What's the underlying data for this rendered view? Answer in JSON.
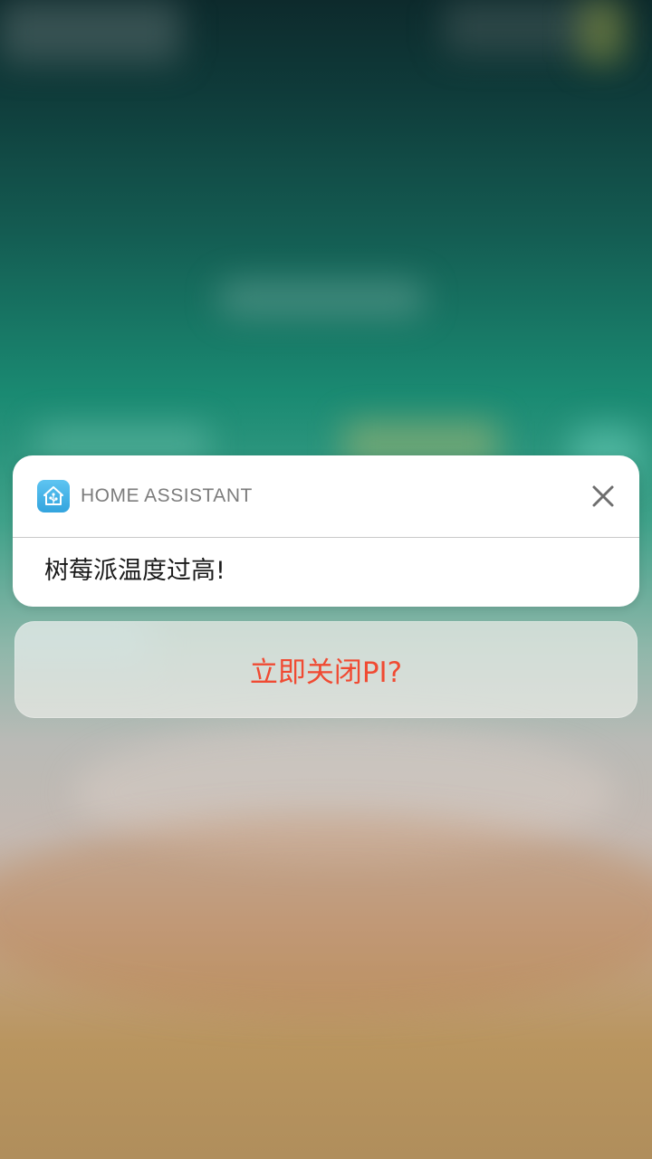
{
  "notification": {
    "app_name": "HOME ASSISTANT",
    "app_icon": "home-assistant-icon",
    "close_icon": "close-icon",
    "message": "树莓派温度过高!"
  },
  "action": {
    "label": "立即关闭PI?",
    "color": "#f04a32"
  },
  "colors": {
    "notification_bg": "#ffffff",
    "app_icon_bg": "#41b0e6",
    "app_name_text": "#7c7c7c",
    "message_text": "#1a1a1a"
  }
}
